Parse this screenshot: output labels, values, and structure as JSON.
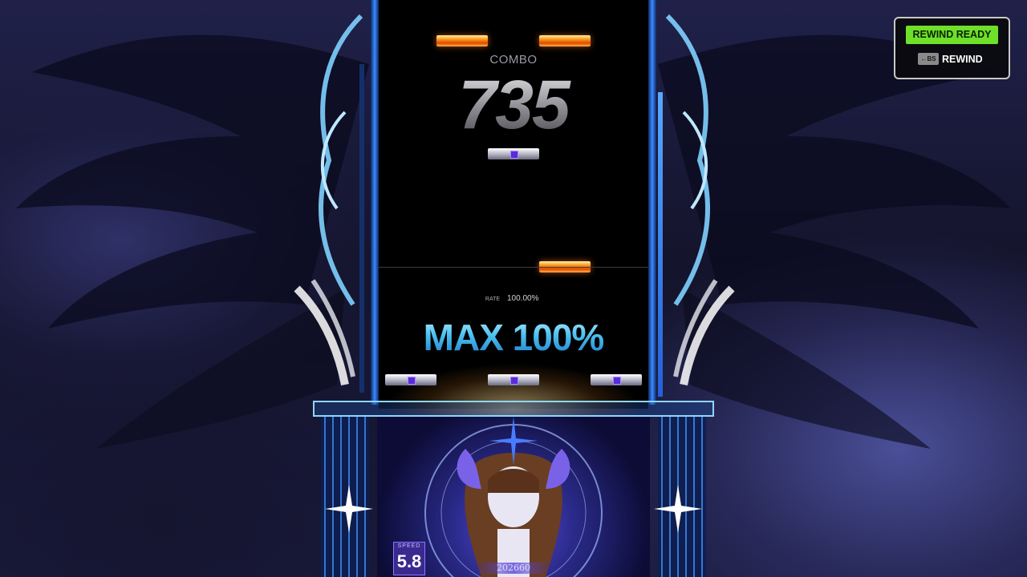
{
  "game": {
    "combo_label": "COMBO",
    "combo_value": "735",
    "rate_label": "RATE",
    "rate_value": "100.00%",
    "judgement_text": "MAX 100%",
    "speed_label": "SPEED",
    "speed_value": "5.8",
    "score_value": "202660"
  },
  "rewind": {
    "ready_label": "REWIND READY",
    "key_label": "←BS",
    "action_label": "REWIND"
  },
  "colors": {
    "rewind_ready_bg": "#6ee02a",
    "note_orange": "#ff9a1e",
    "judgement_blue": "#3ab4e8",
    "lane_border": "#3c8bff"
  },
  "icons": [
    "backspace-key-icon"
  ]
}
